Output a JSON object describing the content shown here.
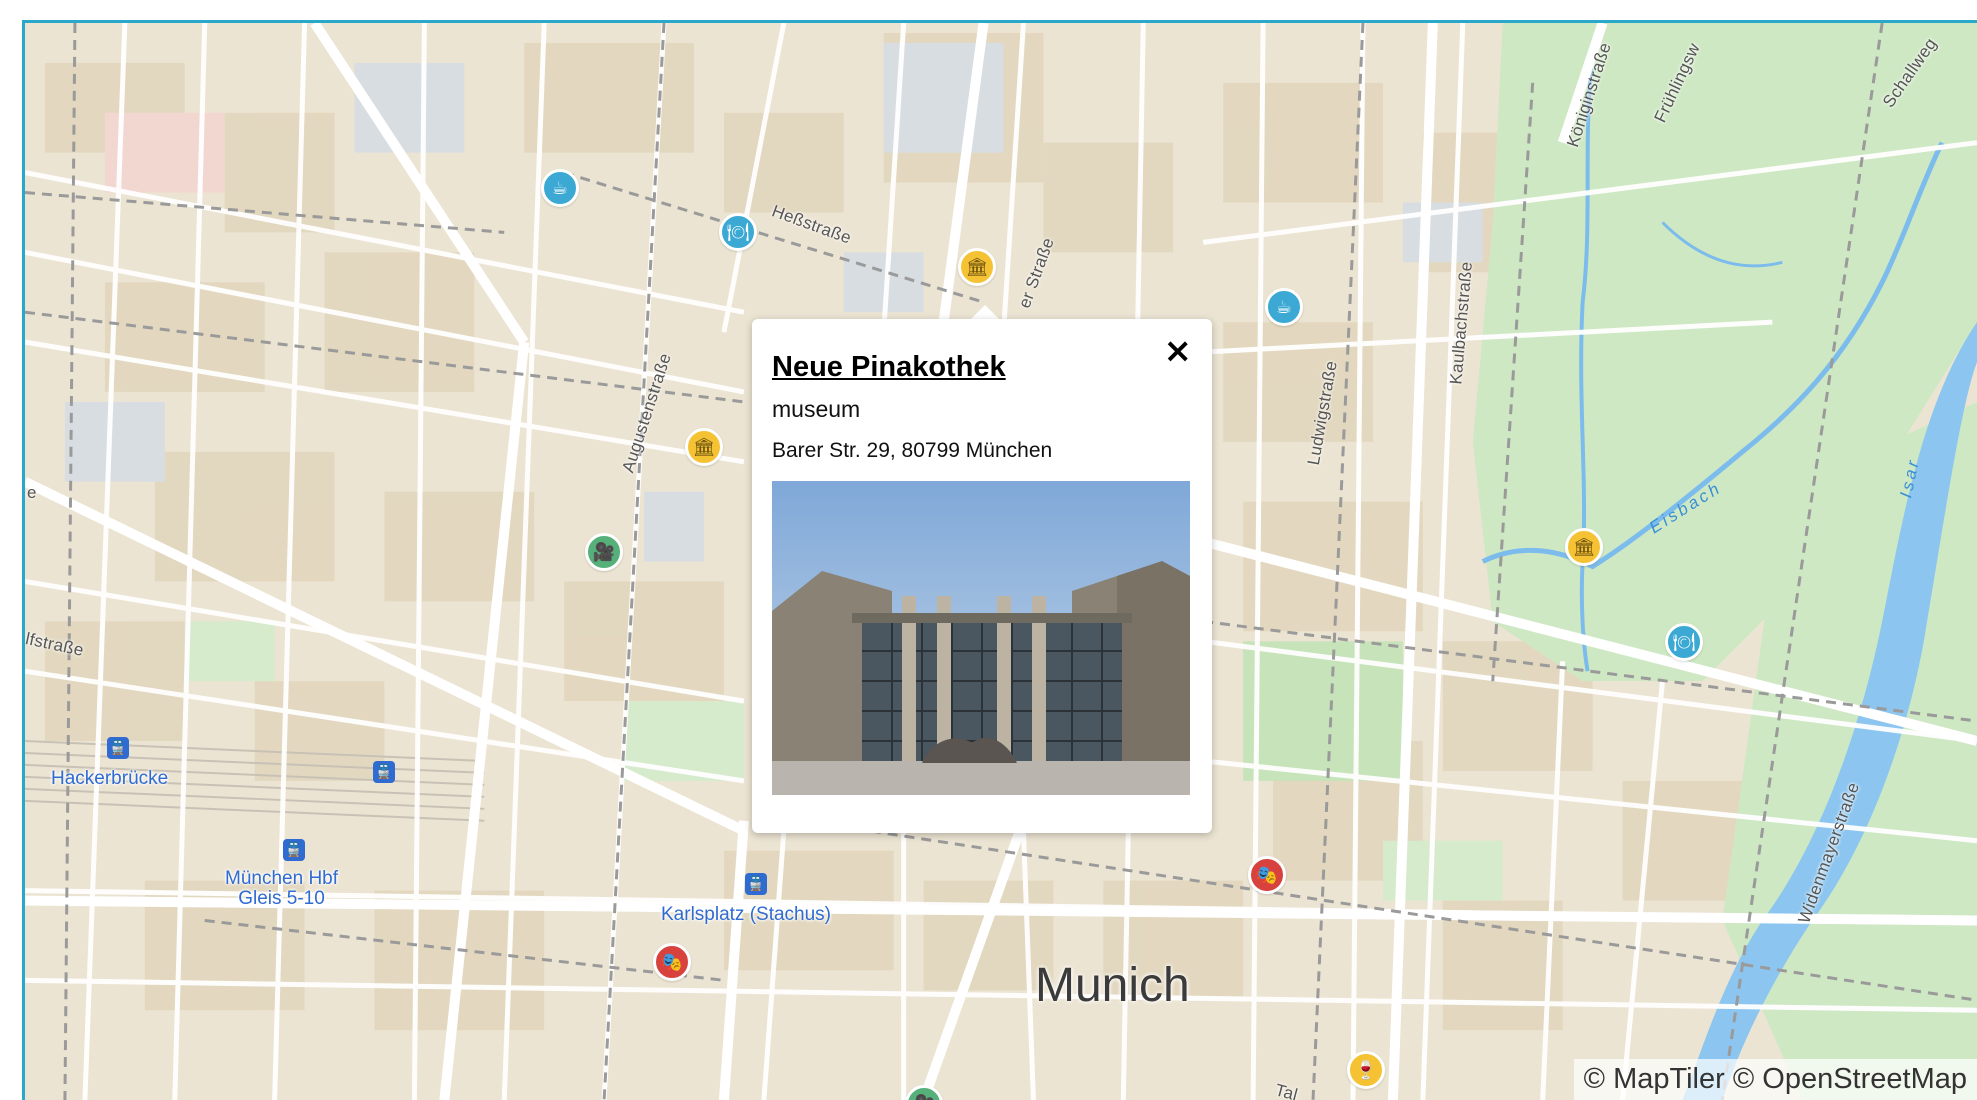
{
  "map": {
    "city_label": "Munich",
    "attribution": "© MapTiler © OpenStreetMap",
    "streets": {
      "hess": "Heßstraße",
      "barer": "er Straße",
      "augusten": "Augustenstraße",
      "ludwig": "Ludwigstraße",
      "kaulbach": "Kaulbachstraße",
      "koenigin": "Königinstraße",
      "fruehling": "Frühlingsw",
      "schall": "Schallweg",
      "widenmayer": "Widenmayerstraße",
      "tal": "Tal",
      "lfstrasse": "lfstraße",
      "e": "e"
    },
    "water": {
      "eisbach": "Eisbach",
      "isar": "Isar"
    },
    "stations": {
      "hackerbruecke": "Hackerbrücke",
      "hbf_line1": "München Hbf",
      "hbf_line2": "Gleis 5-10",
      "karlsplatz": "Karlsplatz (Stachus)"
    },
    "icons": {
      "cafe": "coffee-cup",
      "restaurant": "plate-cutlery",
      "museum": "museum-building",
      "theatre": "theatre-masks",
      "cinema": "film-camera",
      "bar": "wine-glass",
      "station": "train"
    },
    "colors": {
      "cafe": "#3ba9d3",
      "museum": "#f5c233",
      "theatre": "#d8423e",
      "cinema": "#55b07a",
      "transit": "#2f6bd0",
      "water": "#8cc6f0",
      "park": "#cfe8c4",
      "frame": "#29a8c9"
    }
  },
  "popup": {
    "title": "Neue Pinakothek",
    "type": "museum",
    "address": "Barer Str. 29, 80799 München",
    "close_symbol": "×"
  }
}
